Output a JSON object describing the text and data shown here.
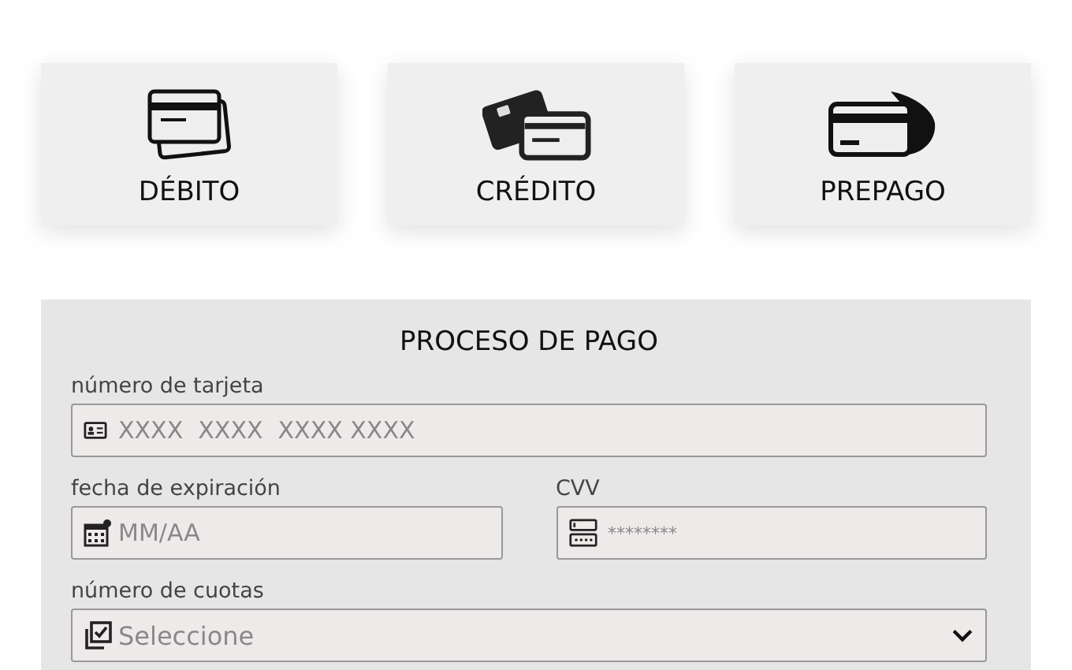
{
  "payment_methods": [
    {
      "label": "DÉBITO",
      "kind": "debit"
    },
    {
      "label": "CRÉDITO",
      "kind": "credit"
    },
    {
      "label": "PREPAGO",
      "kind": "prepaid"
    }
  ],
  "form": {
    "title": "PROCESO DE PAGO",
    "rows": [
      [
        {
          "label": "número de tarjeta",
          "placeholder": "XXXX  XXXX  XXXX XXXX",
          "kind": "number"
        }
      ],
      [
        {
          "label": "fecha de expiración",
          "placeholder": "MM/AA",
          "kind": "date"
        },
        {
          "label": "CVV",
          "placeholder": "********",
          "kind": "cvv"
        }
      ],
      [
        {
          "label": "número de cuotas",
          "placeholder": "Seleccione",
          "kind": "select"
        }
      ]
    ]
  }
}
